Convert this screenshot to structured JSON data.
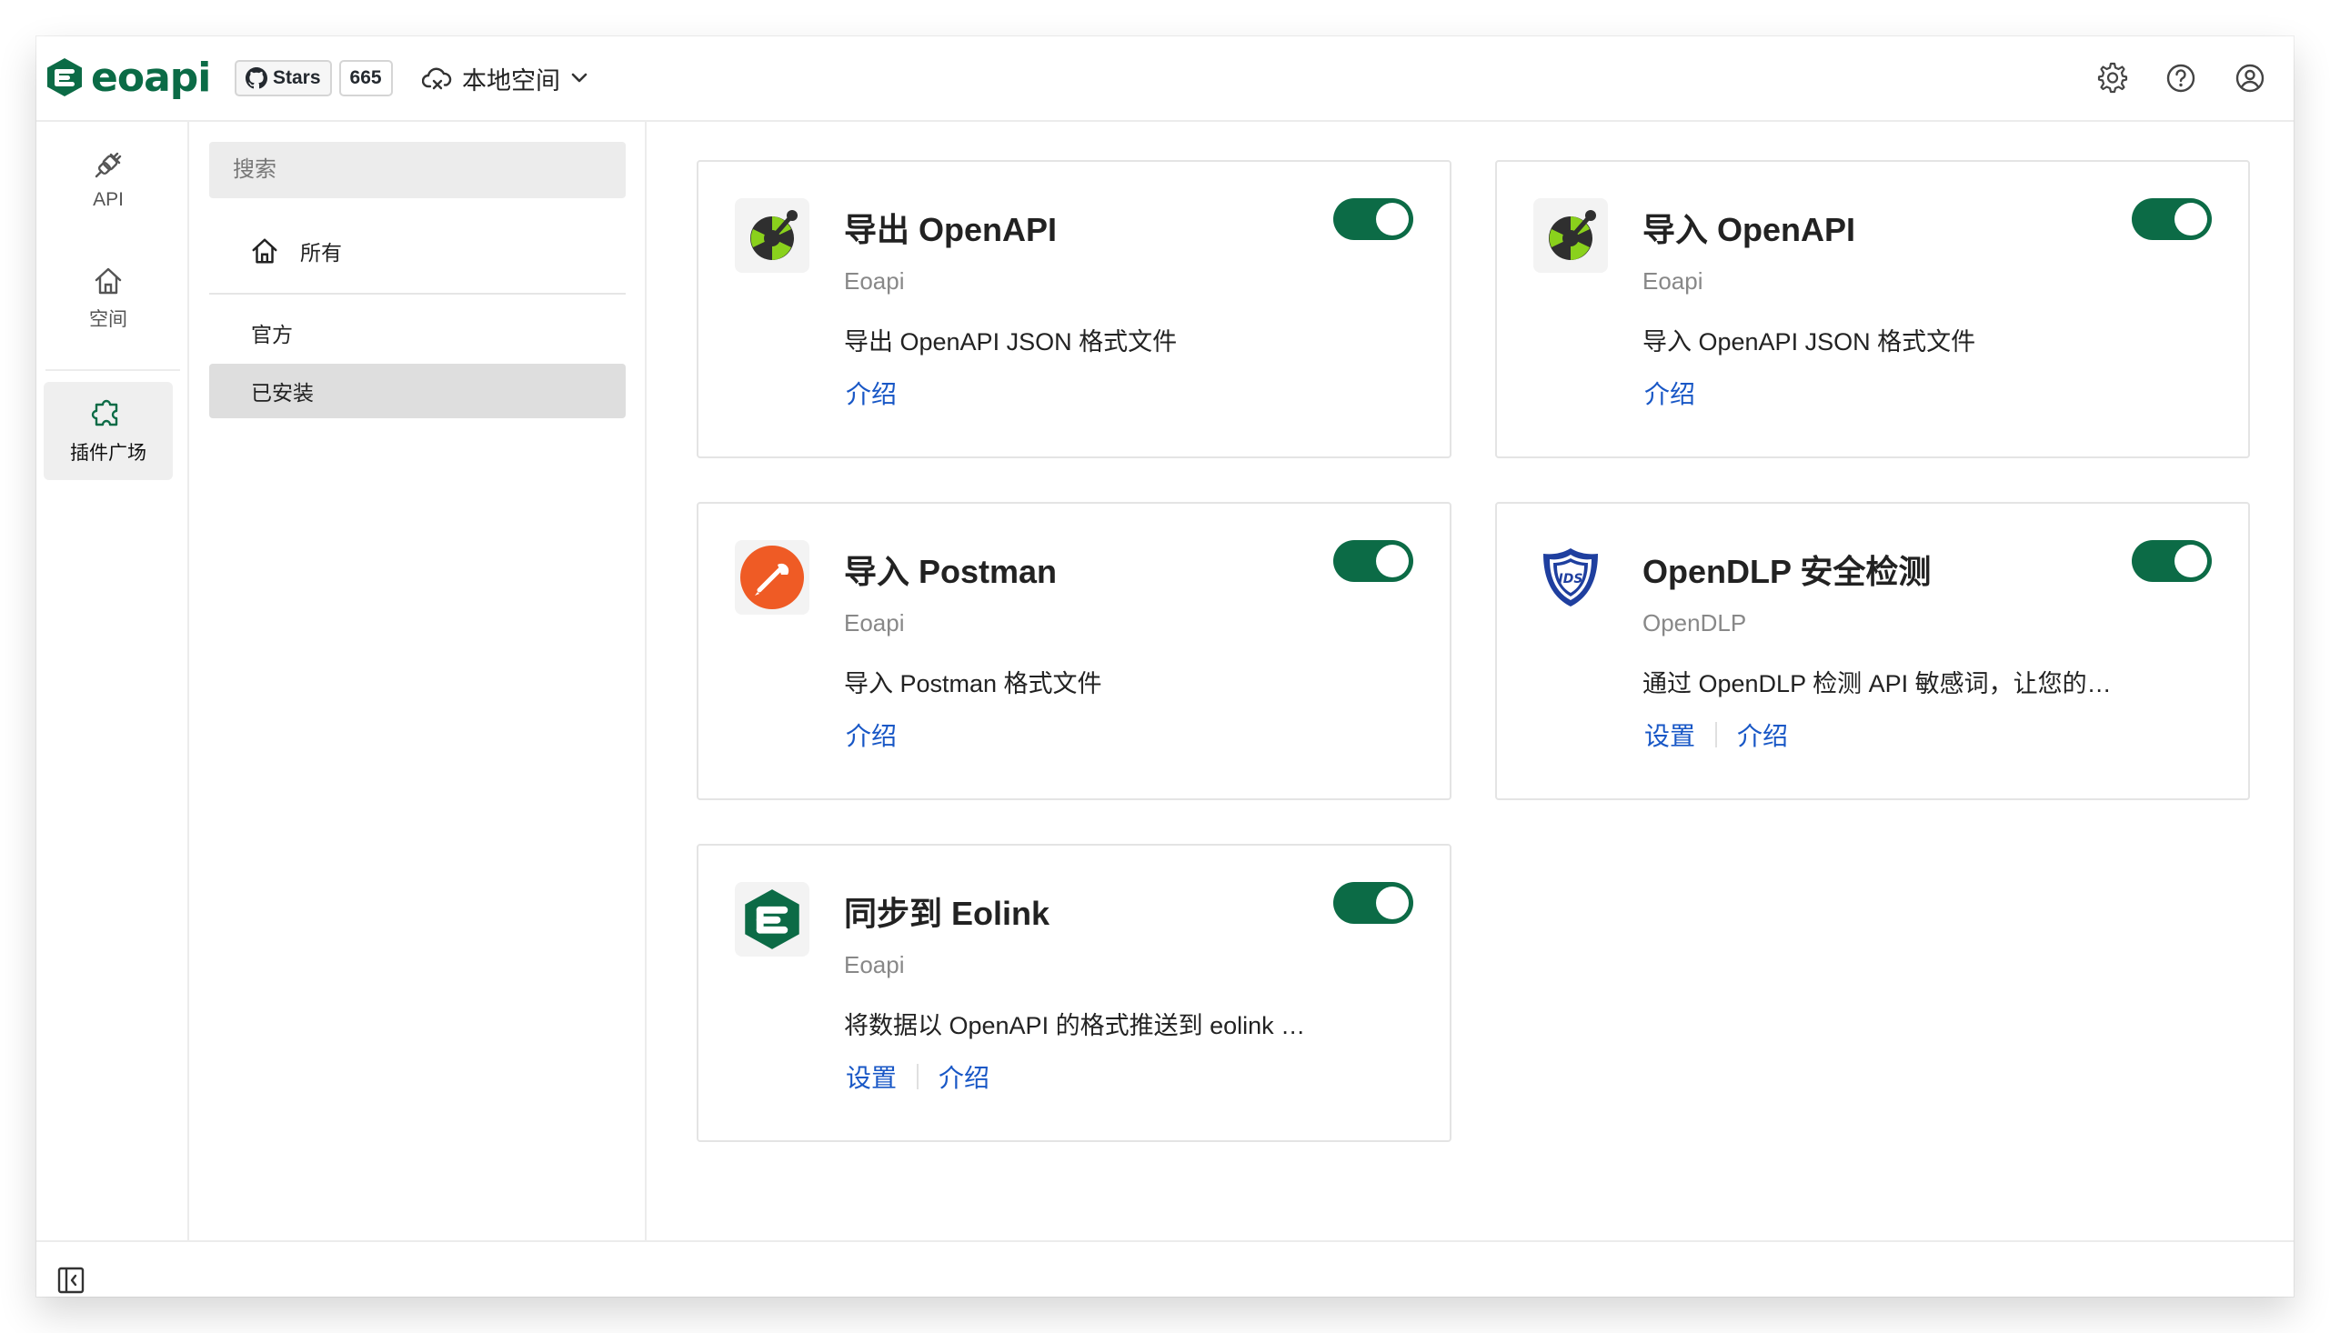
{
  "header": {
    "logo_text": "eoapi",
    "github": {
      "stars_label": "Stars",
      "stars_count": "665"
    },
    "workspace_label": "本地空间"
  },
  "leftnav": {
    "items": [
      {
        "label": "API",
        "icon": "plug-icon"
      },
      {
        "label": "空间",
        "icon": "home-icon"
      },
      {
        "label": "插件广场",
        "icon": "puzzle-icon",
        "active": true
      }
    ]
  },
  "sidebar": {
    "search_placeholder": "搜索",
    "all_label": "所有",
    "categories": [
      {
        "label": "官方"
      },
      {
        "label": "已安装",
        "selected": true
      }
    ]
  },
  "plugins": [
    {
      "title": "导出 OpenAPI",
      "author": "Eoapi",
      "description": "导出 OpenAPI JSON 格式文件",
      "links": [
        "介绍"
      ],
      "enabled": true,
      "icon": "openapi-icon"
    },
    {
      "title": "导入 OpenAPI",
      "author": "Eoapi",
      "description": "导入 OpenAPI JSON 格式文件",
      "links": [
        "介绍"
      ],
      "enabled": true,
      "icon": "openapi-icon"
    },
    {
      "title": "导入 Postman",
      "author": "Eoapi",
      "description": "导入 Postman 格式文件",
      "links": [
        "介绍"
      ],
      "enabled": true,
      "icon": "postman-icon"
    },
    {
      "title": "OpenDLP 安全检测",
      "author": "OpenDLP",
      "description": "通过 OpenDLP 检测 API 敏感词，让您的…",
      "links": [
        "设置",
        "介绍"
      ],
      "enabled": true,
      "icon": "ids-shield-icon"
    },
    {
      "title": "同步到 Eolink",
      "author": "Eoapi",
      "description": "将数据以 OpenAPI 的格式推送到 eolink …",
      "links": [
        "设置",
        "介绍"
      ],
      "enabled": true,
      "icon": "eolink-icon"
    }
  ],
  "colors": {
    "brand": "#0c6b46",
    "link": "#1857c6",
    "postman": "#ef5b25",
    "ids": "#1f3f9f"
  }
}
